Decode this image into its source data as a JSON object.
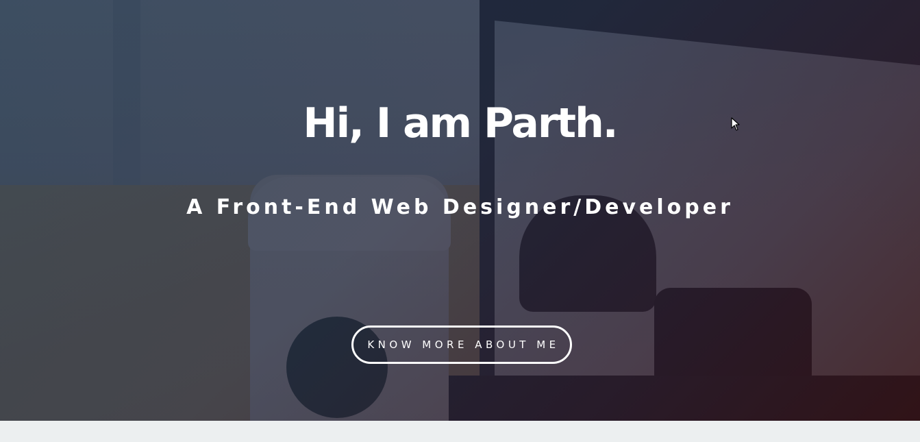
{
  "hero": {
    "title": "Hi, I am Parth.",
    "subtitle": "A Front-End Web Designer/Developer",
    "cta_label": "KNOW MORE ABOUT ME"
  },
  "icons": {
    "cursor": "mouse-pointer-icon"
  },
  "colors": {
    "text": "#ffffff",
    "overlay_start": "#1a2c42",
    "overlay_end": "#341216",
    "page_background": "#eceff0"
  }
}
